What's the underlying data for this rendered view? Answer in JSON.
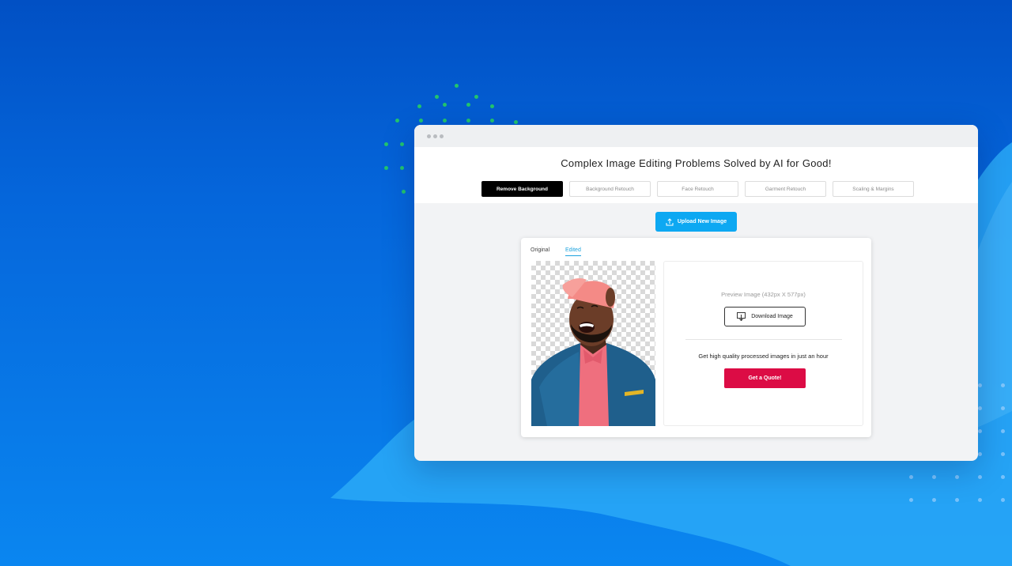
{
  "colors": {
    "background_top": "#0150c4",
    "background_bottom": "#0a86f0",
    "wave": "#2aa9f7",
    "accent_upload": "#0da8f2",
    "accent_quote": "#dc0c45",
    "edited_tab": "#1ea3de",
    "dots_green": "#22c46d"
  },
  "header": {
    "title": "Complex Image Editing Problems Solved by AI for Good!"
  },
  "tabs": [
    {
      "label": "Remove Background",
      "active": true
    },
    {
      "label": "Background Retouch",
      "active": false
    },
    {
      "label": "Face Retouch",
      "active": false
    },
    {
      "label": "Garment Retouch",
      "active": false
    },
    {
      "label": "Scaling & Margins",
      "active": false
    }
  ],
  "upload": {
    "label": "Upload New Image",
    "icon": "upload-icon"
  },
  "view_tabs": {
    "original": "Original",
    "edited": "Edited",
    "active": "edited"
  },
  "preview": {
    "text": "Preview Image (432px X 577px)",
    "download_label": "Download Image",
    "download_icon": "download-icon"
  },
  "promo": {
    "text": "Get high quality processed images in just an hour",
    "quote_label": "Get a Quote!"
  }
}
